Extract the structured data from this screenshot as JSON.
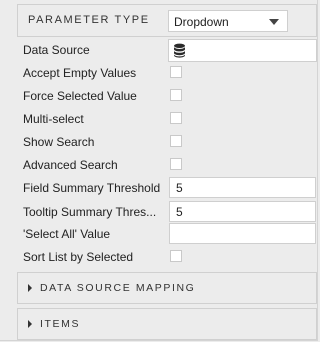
{
  "parameter_type": {
    "label": "PARAMETER TYPE",
    "value": "Dropdown"
  },
  "fields": {
    "data_source": {
      "label": "Data Source",
      "icon": "database-icon"
    },
    "accept_empty_values": {
      "label": "Accept Empty Values",
      "checked": false
    },
    "force_selected_value": {
      "label": "Force Selected Value",
      "checked": false
    },
    "multi_select": {
      "label": "Multi-select",
      "checked": false
    },
    "show_search": {
      "label": "Show Search",
      "checked": false
    },
    "advanced_search": {
      "label": "Advanced Search",
      "checked": false
    },
    "field_summary_threshold": {
      "label": "Field Summary Threshold",
      "value": "5"
    },
    "tooltip_summary_threshold": {
      "label": "Tooltip Summary Thres...",
      "value": "5"
    },
    "select_all_value": {
      "label": "'Select All' Value",
      "value": ""
    },
    "sort_list_by_selected": {
      "label": "Sort List by Selected",
      "checked": false
    }
  },
  "sections": {
    "data_source_mapping": {
      "label": "DATA SOURCE MAPPING",
      "expanded": false
    },
    "items": {
      "label": "ITEMS",
      "expanded": false
    }
  }
}
